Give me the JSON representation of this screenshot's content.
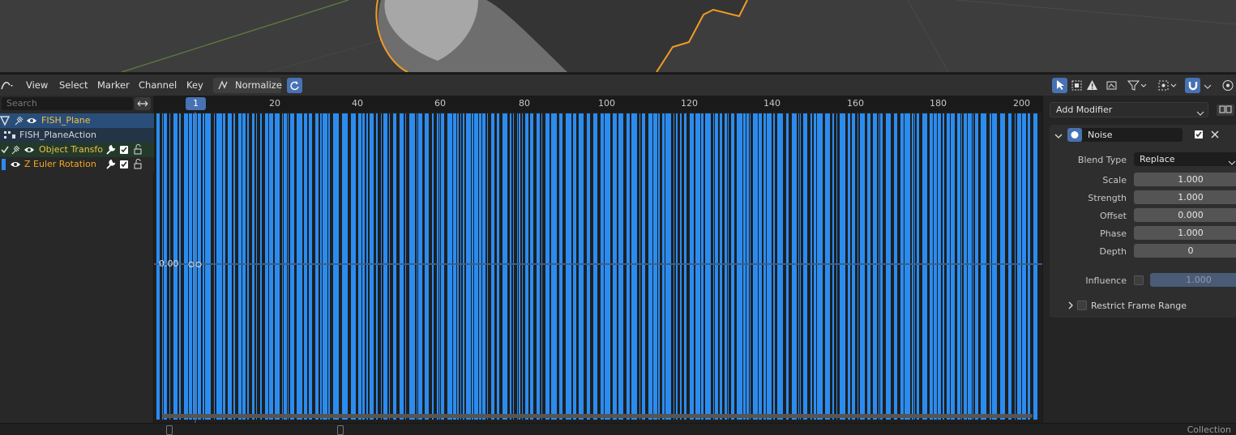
{
  "menu": {
    "view": "View",
    "select": "Select",
    "marker": "Marker",
    "channel": "Channel",
    "key": "Key",
    "normalize": "Normalize"
  },
  "search": {
    "placeholder": "Search"
  },
  "channels": {
    "object": "FISH_Plane",
    "action": "FISH_PlaneAction",
    "group": "Object Transfo",
    "fcurve": "Z Euler Rotation"
  },
  "timeline": {
    "current_frame": "1",
    "ticks": [
      "20",
      "40",
      "60",
      "80",
      "100",
      "120",
      "140",
      "160",
      "180",
      "200"
    ],
    "value_label": "0.00"
  },
  "properties": {
    "add_modifier": "Add Modifier",
    "modifier_name": "Noise",
    "blend_type_label": "Blend Type",
    "blend_type_value": "Replace",
    "fields": [
      {
        "label": "Scale",
        "value": "1.000"
      },
      {
        "label": "Strength",
        "value": "1.000"
      },
      {
        "label": "Offset",
        "value": "0.000"
      },
      {
        "label": "Phase",
        "value": "1.000"
      },
      {
        "label": "Depth",
        "value": "0"
      }
    ],
    "influence_label": "Influence",
    "influence_value": "1.000",
    "restrict_label": "Restrict Frame Range"
  },
  "footer": {
    "status": "Collection"
  },
  "colors": {
    "accent": "#4772b3",
    "curve_blue": "#2b8cf0",
    "selection_orange": "#f5a623",
    "object_name": "#f0c246"
  }
}
